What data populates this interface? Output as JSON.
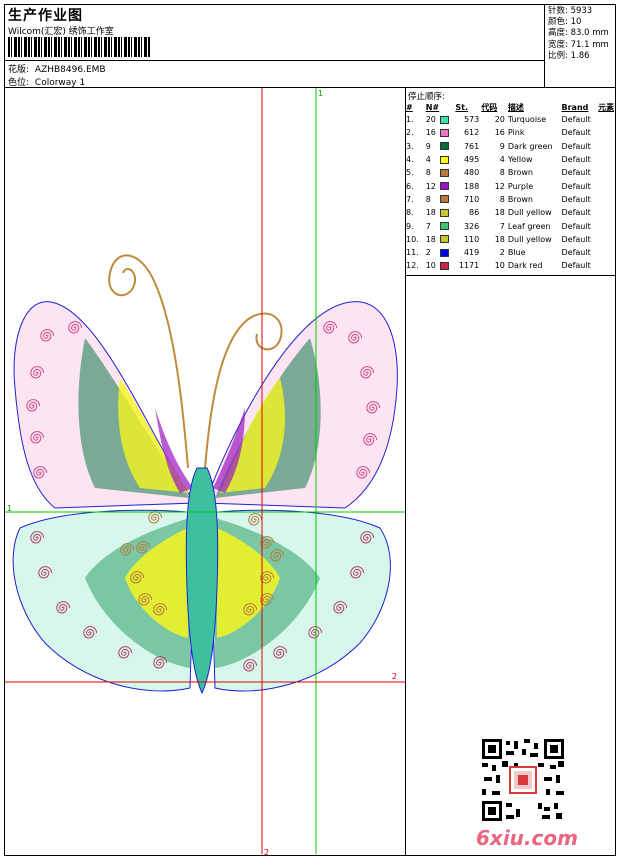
{
  "header": {
    "title": "生产作业图",
    "company": "Wilcom(汇宏) 绣饰工作室",
    "design_label": "花版:",
    "design_file": "AZHB8496.EMB",
    "colorway_label": "色位:",
    "colorway": "Colorway 1"
  },
  "stats": [
    {
      "label": "针数:",
      "value": "5933"
    },
    {
      "label": "颜色:",
      "value": "10"
    },
    {
      "label": "高度:",
      "value": "83.0 mm"
    },
    {
      "label": "宽度:",
      "value": "71.1 mm"
    },
    {
      "label": "比例:",
      "value": "1.86"
    }
  ],
  "stop_sequence": {
    "title": "停止顺序:",
    "columns": [
      "#",
      "N#",
      "St.",
      "代码",
      "描述",
      "Brand",
      "元素"
    ],
    "rows": [
      {
        "idx": "1.",
        "n": "20",
        "color": "#40e0b0",
        "st": "573",
        "code": "20",
        "desc": "Turquoise",
        "brand": "Default"
      },
      {
        "idx": "2.",
        "n": "16",
        "color": "#ec78c4",
        "st": "612",
        "code": "16",
        "desc": "Pink",
        "brand": "Default"
      },
      {
        "idx": "3.",
        "n": "9",
        "color": "#0a6b3c",
        "st": "761",
        "code": "9",
        "desc": "Dark green",
        "brand": "Default"
      },
      {
        "idx": "4.",
        "n": "4",
        "color": "#ffff00",
        "st": "495",
        "code": "4",
        "desc": "Yellow",
        "brand": "Default"
      },
      {
        "idx": "5.",
        "n": "8",
        "color": "#b57a3c",
        "st": "480",
        "code": "8",
        "desc": "Brown",
        "brand": "Default"
      },
      {
        "idx": "6.",
        "n": "12",
        "color": "#a010c8",
        "st": "188",
        "code": "12",
        "desc": "Purple",
        "brand": "Default"
      },
      {
        "idx": "7.",
        "n": "8",
        "color": "#b57a3c",
        "st": "710",
        "code": "8",
        "desc": "Brown",
        "brand": "Default"
      },
      {
        "idx": "8.",
        "n": "18",
        "color": "#c8c832",
        "st": "86",
        "code": "18",
        "desc": "Dull yellow",
        "brand": "Default"
      },
      {
        "idx": "9.",
        "n": "7",
        "color": "#3cc46e",
        "st": "326",
        "code": "7",
        "desc": "Leaf green",
        "brand": "Default"
      },
      {
        "idx": "10.",
        "n": "18",
        "color": "#c8c832",
        "st": "110",
        "code": "18",
        "desc": "Dull yellow",
        "brand": "Default"
      },
      {
        "idx": "11.",
        "n": "2",
        "color": "#0000e6",
        "st": "419",
        "code": "2",
        "desc": "Blue",
        "brand": "Default"
      },
      {
        "idx": "12.",
        "n": "10",
        "color": "#c82846",
        "st": "1171",
        "code": "10",
        "desc": "Dark red",
        "brand": "Default"
      }
    ]
  },
  "guides": {
    "v_green": "1",
    "h_green": "1",
    "v_red": "2",
    "h_red": "2"
  },
  "watermark": "6xiu.com",
  "colors": {
    "guide_green": "#00c800",
    "guide_red": "#e00000",
    "outline_blue": "#2020d0"
  }
}
